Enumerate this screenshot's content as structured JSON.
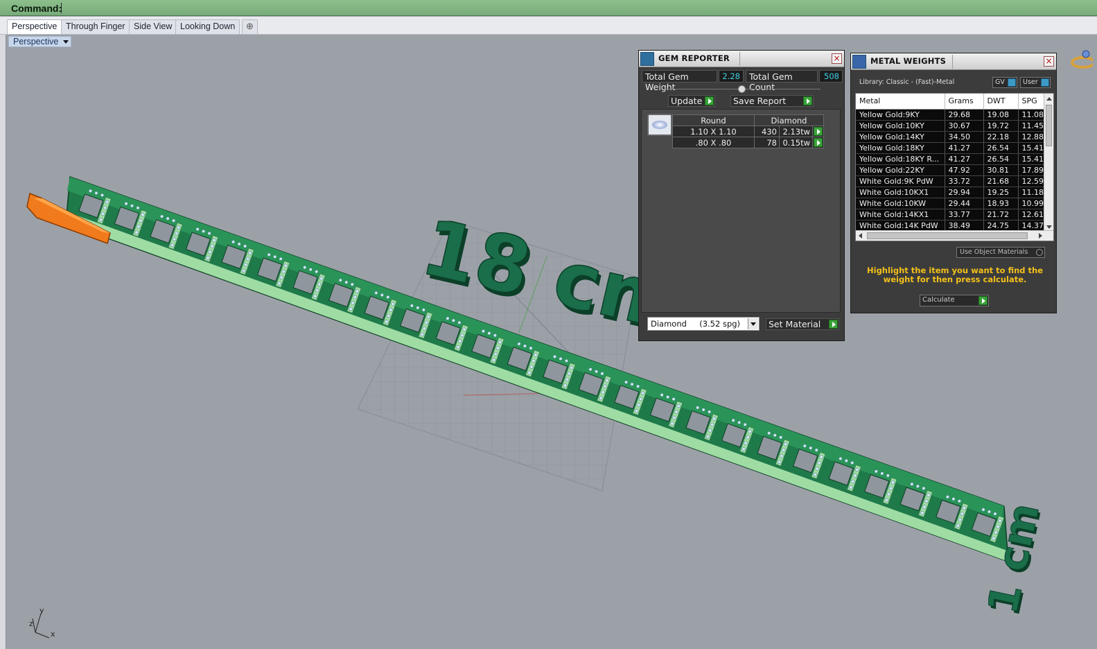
{
  "command_bar": {
    "label": "Command:"
  },
  "tabs": [
    {
      "label": "Perspective",
      "active": true
    },
    {
      "label": "Through Finger"
    },
    {
      "label": "Side View"
    },
    {
      "label": "Looking Down"
    }
  ],
  "add_tab_icon": "plus-icon",
  "viewport": {
    "title": "Perspective",
    "annotations": {
      "length_label": "18 cm",
      "width_label": "1 cm"
    },
    "axis": {
      "x": "x",
      "y": "y",
      "z": "z"
    },
    "colors": {
      "bracelet_dark": "#1f7a4a",
      "bracelet_light": "#9fdca4",
      "clasp": "#f07a1c",
      "text3d": "#1a6e4a"
    }
  },
  "gem_reporter": {
    "title": "GEM REPORTER",
    "total_weight_label": "Total Gem Weight",
    "total_weight_value": "2.28",
    "total_count_label": "Total Gem Count",
    "total_count_value": "508",
    "update_label": "Update",
    "save_label": "Save Report",
    "table": {
      "headers": [
        "Round",
        "Diamond"
      ],
      "rows": [
        {
          "size": "1.10 X 1.10",
          "count": "430",
          "weight": "2.13tw"
        },
        {
          "size": ".80 X .80",
          "count": "78",
          "weight": "0.15tw"
        }
      ]
    },
    "material_select": "Diamond     (3.52 spg)",
    "set_material_label": "Set Material"
  },
  "metal_weights": {
    "title": "METAL WEIGHTS",
    "library": "Library: Classic - (Fast)-Metal",
    "gv_label": "GV",
    "user_label": "User",
    "columns": [
      "Metal",
      "Grams",
      "DWT",
      "SPG"
    ],
    "rows": [
      [
        "Yellow Gold:9KY",
        "29.68",
        "19.08",
        "11.08"
      ],
      [
        "Yellow Gold:10KY",
        "30.67",
        "19.72",
        "11.45"
      ],
      [
        "Yellow Gold:14KY",
        "34.50",
        "22.18",
        "12.88"
      ],
      [
        "Yellow Gold:18KY",
        "41.27",
        "26.54",
        "15.41"
      ],
      [
        "Yellow Gold:18KY R...",
        "41.27",
        "26.54",
        "15.41"
      ],
      [
        "Yellow Gold:22KY",
        "47.92",
        "30.81",
        "17.89"
      ],
      [
        "White Gold:9K PdW",
        "33.72",
        "21.68",
        "12.59"
      ],
      [
        "White Gold:10KX1",
        "29.94",
        "19.25",
        "11.18"
      ],
      [
        "White Gold:10KW",
        "29.44",
        "18.93",
        "10.99"
      ],
      [
        "White Gold:14KX1",
        "33.77",
        "21.72",
        "12.61"
      ],
      [
        "White Gold:14K PdW",
        "38.49",
        "24.75",
        "14.37"
      ]
    ],
    "use_object_label": "Use Object Materials",
    "hint": "Highlight the item you want to find the weight for then press calculate.",
    "calculate_label": "Calculate"
  }
}
